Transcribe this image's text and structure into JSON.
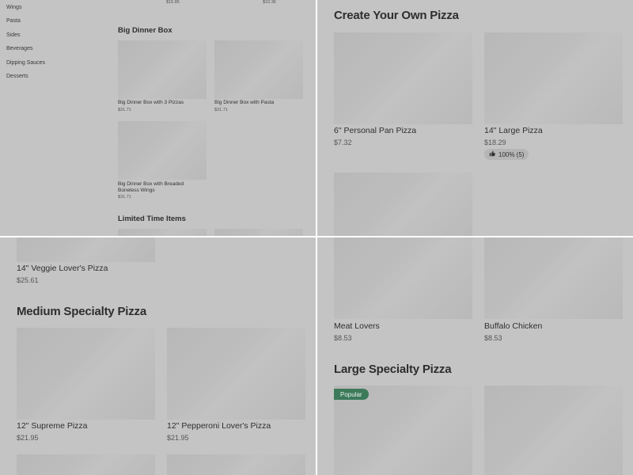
{
  "sidebar": {
    "categories": [
      "Wings",
      "Pasta",
      "Sides",
      "Beverages",
      "Dipping Sauces",
      "Desserts"
    ]
  },
  "top_left": {
    "top_prices": [
      "$15.85",
      "$10.36"
    ],
    "big_dinner_box": {
      "heading": "Big Dinner Box",
      "items": [
        {
          "name": "Big Dinner Box with 3 Pizzas",
          "price": "$31.71"
        },
        {
          "name": "Big Dinner Box with Pasta",
          "price": "$31.71"
        },
        {
          "name_line1": "Big Dinner Box with Breaded",
          "name_line2": "Boneless Wings",
          "price": "$31.71"
        }
      ]
    },
    "limited_heading": "Limited Time Items"
  },
  "top_right": {
    "heading": "Create Your Own Pizza",
    "items": [
      {
        "name": "6\" Personal Pan Pizza",
        "price": "$7.32"
      },
      {
        "name": "14\" Large Pizza",
        "price": "$18.29",
        "rating": "100% (5)"
      }
    ]
  },
  "bottom_left": {
    "partial_item": {
      "name": "14\" Veggie Lover's Pizza",
      "price": "$25.61"
    },
    "heading": "Medium Specialty Pizza",
    "items": [
      {
        "name": "12\" Supreme Pizza",
        "price": "$21.95"
      },
      {
        "name": "12\" Pepperoni Lover's Pizza",
        "price": "$21.95"
      }
    ]
  },
  "bottom_right": {
    "items": [
      {
        "name": "Meat Lovers",
        "price": "$8.53"
      },
      {
        "name": "Buffalo Chicken",
        "price": "$8.53"
      }
    ],
    "heading": "Large Specialty Pizza",
    "badge": "Popular"
  },
  "colors": {
    "overlay_gray": "#c4c4c4",
    "badge_green": "#3c7a5a",
    "divider": "#ffffff"
  }
}
